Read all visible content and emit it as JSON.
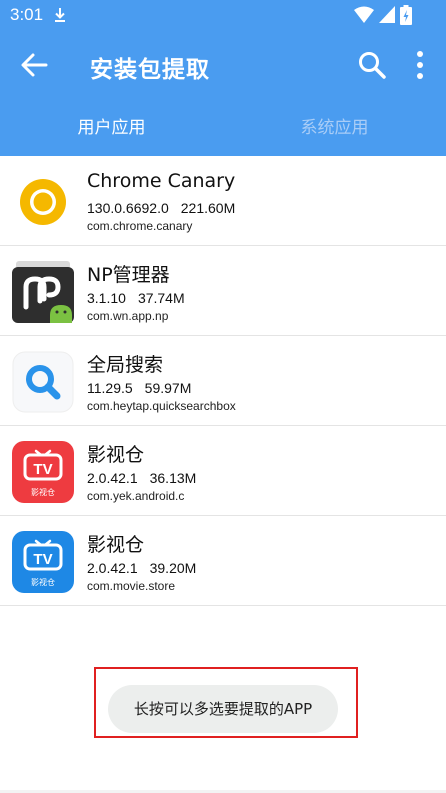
{
  "status_bar": {
    "time": "3:01",
    "icons": [
      "download-icon",
      "wifi-icon",
      "signal-icon",
      "battery-icon"
    ]
  },
  "app_bar": {
    "title": "安装包提取",
    "icons": [
      "back-arrow-icon",
      "search-icon",
      "more-vert-icon"
    ]
  },
  "tabs": [
    {
      "label": "用户应用",
      "selected": true
    },
    {
      "label": "系统应用",
      "selected": false
    }
  ],
  "apps": [
    {
      "name": "Chrome Canary",
      "version": "130.0.6692.0",
      "size": "221.60M",
      "package": "com.chrome.canary",
      "icon": "chrome-canary-icon"
    },
    {
      "name": "NP管理器",
      "version": "3.1.10",
      "size": "37.74M",
      "package": "com.wn.app.np",
      "icon": "np-manager-icon"
    },
    {
      "name": "全局搜索",
      "version": "11.29.5",
      "size": "59.97M",
      "package": "com.heytap.quicksearchbox",
      "icon": "global-search-icon"
    },
    {
      "name": "影视仓",
      "version": "2.0.42.1",
      "size": "36.13M",
      "package": "com.yek.android.c",
      "icon": "tv-red-icon",
      "icon_caption": "影视仓"
    },
    {
      "name": "影视仓",
      "version": "2.0.42.1",
      "size": "39.20M",
      "package": "com.movie.store",
      "icon": "tv-blue-icon",
      "icon_caption": "影视仓"
    }
  ],
  "toast": {
    "text": "长按可以多选要提取的APP"
  },
  "colors": {
    "primary": "#4a9cf0",
    "tab_inactive": "#a9cdf7",
    "highlight": "#e02020",
    "toast_bg": "#eceeed"
  }
}
